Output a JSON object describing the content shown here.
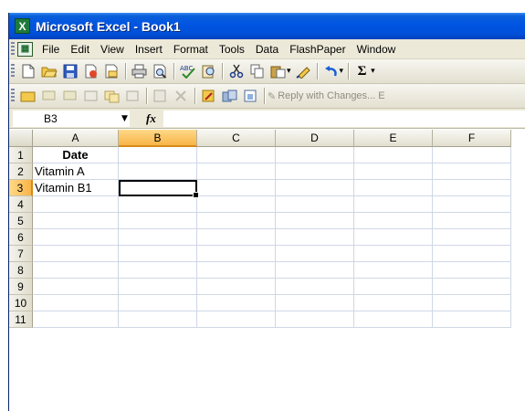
{
  "window": {
    "title": "Microsoft Excel - Book1"
  },
  "menubar": {
    "items": [
      {
        "label": "File"
      },
      {
        "label": "Edit"
      },
      {
        "label": "View"
      },
      {
        "label": "Insert"
      },
      {
        "label": "Format"
      },
      {
        "label": "Tools"
      },
      {
        "label": "Data"
      },
      {
        "label": "FlashPaper"
      },
      {
        "label": "Window"
      }
    ]
  },
  "toolbar1": {
    "icons": [
      "new-icon",
      "open-icon",
      "save-icon",
      "permission-icon",
      "email-icon",
      "print-icon",
      "print-preview-icon",
      "spelling-icon",
      "research-icon",
      "cut-icon",
      "copy-icon",
      "paste-icon",
      "format-painter-icon",
      "undo-icon",
      "autosum-icon"
    ],
    "sigma": "Σ"
  },
  "toolbar2": {
    "reply_with_changes": "Reply with Changes... E"
  },
  "formulabar": {
    "name_box": "B3",
    "fx": "fx",
    "formula": ""
  },
  "grid": {
    "columns": [
      "A",
      "B",
      "C",
      "D",
      "E",
      "F"
    ],
    "active_column": "B",
    "active_row": 3,
    "rows": [
      {
        "num": "1",
        "a": "Date"
      },
      {
        "num": "2",
        "a": "Vitamin A"
      },
      {
        "num": "3",
        "a": "Vitamin B1"
      },
      {
        "num": "4",
        "a": ""
      },
      {
        "num": "5",
        "a": ""
      },
      {
        "num": "6",
        "a": ""
      },
      {
        "num": "7",
        "a": ""
      },
      {
        "num": "8",
        "a": ""
      },
      {
        "num": "9",
        "a": ""
      },
      {
        "num": "10",
        "a": ""
      },
      {
        "num": "11",
        "a": ""
      }
    ]
  }
}
